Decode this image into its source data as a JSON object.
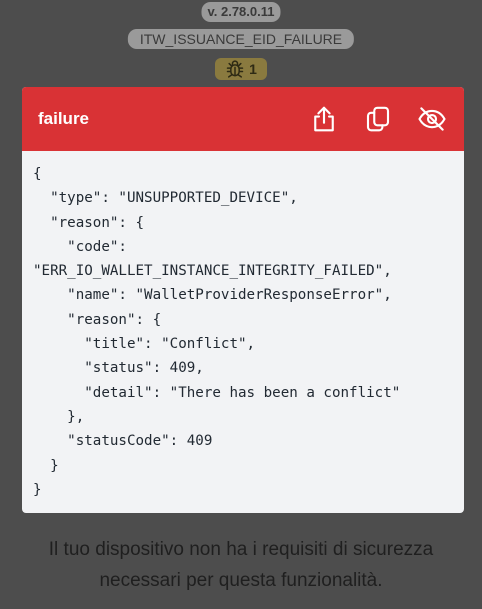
{
  "header": {
    "version": "v. 2.78.0.11",
    "event_name": "ITW_ISSUANCE_EID_FAILURE",
    "debug_badge": {
      "icon": "bug-icon",
      "count": "1"
    }
  },
  "card": {
    "title": "failure",
    "actions": [
      {
        "name": "share",
        "icon": "share-icon"
      },
      {
        "name": "copy",
        "icon": "copy-icon"
      },
      {
        "name": "hide",
        "icon": "eye-off-icon"
      }
    ],
    "json_lines": [
      "{",
      "  \"type\": \"UNSUPPORTED_DEVICE\",",
      "  \"reason\": {",
      "    \"code\":",
      "\"ERR_IO_WALLET_INSTANCE_INTEGRITY_FAILED\",",
      "    \"name\": \"WalletProviderResponseError\",",
      "    \"reason\": {",
      "      \"title\": \"Conflict\",",
      "      \"status\": 409,",
      "      \"detail\": \"There has been a conflict\"",
      "    },",
      "    \"statusCode\": 409",
      "  }",
      "}"
    ]
  },
  "footer": {
    "line1": "Il tuo dispositivo non ha i requisiti di sicurezza",
    "line2": "necessari per questa funzionalità."
  },
  "colors": {
    "background": "#4d4d4d",
    "card_header": "#d93235",
    "card_body": "#f2f3f5",
    "badge": "#8a7a3f"
  }
}
